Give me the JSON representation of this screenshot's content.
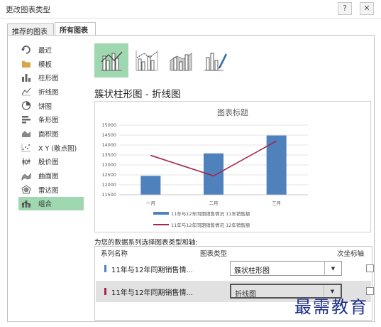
{
  "window": {
    "title": "更改图表类型",
    "help_glyph": "?",
    "close_glyph": "✕"
  },
  "tabs": [
    {
      "label": "推荐的图表",
      "selected": false
    },
    {
      "label": "所有图表",
      "selected": true
    }
  ],
  "chart_types": [
    {
      "label": "最近",
      "icon": "recent-icon"
    },
    {
      "label": "模板",
      "icon": "folder-icon"
    },
    {
      "label": "柱形图",
      "icon": "column-chart-icon"
    },
    {
      "label": "折线图",
      "icon": "line-chart-icon"
    },
    {
      "label": "饼图",
      "icon": "pie-chart-icon"
    },
    {
      "label": "条形图",
      "icon": "bar-chart-icon"
    },
    {
      "label": "面积图",
      "icon": "area-chart-icon"
    },
    {
      "label": "X Y (散点图)",
      "icon": "scatter-chart-icon"
    },
    {
      "label": "股价图",
      "icon": "stock-chart-icon"
    },
    {
      "label": "曲面图",
      "icon": "surface-chart-icon"
    },
    {
      "label": "雷达图",
      "icon": "radar-chart-icon"
    },
    {
      "label": "组合",
      "icon": "combo-chart-icon",
      "selected": true
    }
  ],
  "variants": [
    {
      "icon": "clustered-column-line-icon",
      "selected": true
    },
    {
      "icon": "clustered-column-line-secondary-icon",
      "selected": false
    },
    {
      "icon": "stacked-area-clustered-column-icon",
      "selected": false
    },
    {
      "icon": "custom-combination-icon",
      "selected": false
    }
  ],
  "subtype_title": "簇状柱形图 - 折线图",
  "prompt": "为您的数据系列选择图表类型和轴:",
  "series_table": {
    "headers": {
      "name": "系列名称",
      "type": "图表类型",
      "secondary": "次坐标轴"
    },
    "rows": [
      {
        "name": "11年与12年同期销售情...",
        "type": "簇状柱形图",
        "color": "#4f81bd",
        "secondary_axis": false
      },
      {
        "name": "11年与12年同期销售情...",
        "type": "折线图",
        "color": "#a62548",
        "secondary_axis": false
      }
    ],
    "dropdown_glyph": "▼"
  },
  "colors": {
    "accent_selected": "#9fd7b0",
    "bar_series": "#4f81bd",
    "line_series": "#a62548"
  },
  "chart_data": {
    "type": "bar",
    "title": "图表标题",
    "categories": [
      "一月",
      "二月",
      "三月"
    ],
    "ylim": [
      11500,
      15000
    ],
    "yticks": [
      11500,
      12000,
      12500,
      13000,
      13500,
      14000,
      14500,
      15000
    ],
    "grid": true,
    "legend_position": "bottom",
    "series": [
      {
        "name": "11年与12年同期销售情况 11年销售额",
        "type": "bar",
        "values": [
          12450,
          13580,
          14480
        ]
      },
      {
        "name": "11年与12年同期销售情况 12年销售额",
        "type": "line",
        "values": [
          13480,
          12450,
          14200
        ]
      }
    ]
  },
  "watermark": "最需教育"
}
